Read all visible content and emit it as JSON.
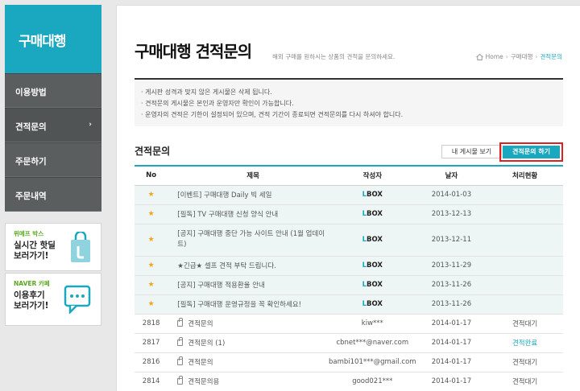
{
  "sidebar": {
    "title": "구매대행",
    "items": [
      {
        "label": "이용방법"
      },
      {
        "label": "견적문의",
        "arrow": "›"
      },
      {
        "label": "주문하기"
      },
      {
        "label": "주문내역"
      }
    ]
  },
  "banners": [
    {
      "tag": "위메프 박스",
      "line1": "실시간 핫딜",
      "line2": "보러가기!",
      "icon": "shopping-bag-icon"
    },
    {
      "tag": "NAVER 카페",
      "line1": "이용후기",
      "line2": "보러가기!",
      "icon": "chat-bubble-icon"
    }
  ],
  "header": {
    "title": "구매대행 견적문의",
    "description": "해외 구매를 원하시는 상품의 견적을 문의하세요.",
    "breadcrumb": {
      "home": "Home",
      "sep1": "›",
      "level1": "구매대행",
      "sep2": "›",
      "current": "견적문의"
    }
  },
  "notice": [
    "· 게시판 성격과 맞지 않은 게시물은 삭제 됩니다.",
    "· 견적문의 게시물은 본인과 운영자만 확인이 가능합니다.",
    "· 운영자의 견적은 기한이 설정되어 있으며, 견적 기간이 종료되면 견적문의를 다시 하셔야 합니다."
  ],
  "section": {
    "title": "견적문의",
    "my_posts_button": "내 게시물 보기",
    "ask_button": "견적문의 하기"
  },
  "table": {
    "headers": [
      "No",
      "제목",
      "작성자",
      "날자",
      "처리현황"
    ],
    "pinned": [
      {
        "subject": "[이벤트] 구매대행 Daily 빅 세일",
        "writer_l": "L",
        "writer": "BOX",
        "date": "2014-01-03",
        "status": ""
      },
      {
        "subject": "[필독] TV 구매대행 신청 양식 안내",
        "writer_l": "L",
        "writer": "BOX",
        "date": "2013-12-13",
        "status": ""
      },
      {
        "subject": "[공지] 구매대행 중단 가능 사이트 안내 (1월 업데이트)",
        "writer_l": "L",
        "writer": "BOX",
        "date": "2013-12-11",
        "status": ""
      },
      {
        "subject": "★긴급★ 셀프 견적 부탁 드립니다.",
        "writer_l": "L",
        "writer": "BOX",
        "date": "2013-11-29",
        "status": ""
      },
      {
        "subject": "[공지] 구매대행 적용환율 안내",
        "writer_l": "L",
        "writer": "BOX",
        "date": "2013-11-26",
        "status": ""
      },
      {
        "subject": "[필독] 구매대행 운영규정을 꼭 확인하세요!",
        "writer_l": "L",
        "writer": "BOX",
        "date": "2013-11-26",
        "status": ""
      }
    ],
    "rows": [
      {
        "no": "2818",
        "subject": "견적문의",
        "writer": "kiw***",
        "date": "2014-01-17",
        "status": "견적대기",
        "done": false
      },
      {
        "no": "2817",
        "subject": "견적문의 (1)",
        "writer": "cbnet***@naver.com",
        "date": "2014-01-17",
        "status": "견적완료",
        "done": true
      },
      {
        "no": "2816",
        "subject": "견적문의",
        "writer": "bambi101***@gmail.com",
        "date": "2014-01-17",
        "status": "견적대기",
        "done": false
      },
      {
        "no": "2814",
        "subject": "견적문의용",
        "writer": "good021***",
        "date": "2014-01-17",
        "status": "견적대기",
        "done": false
      }
    ]
  },
  "colors": {
    "accent": "#1aa8c0",
    "highlight_border": "#e02020",
    "star": "#f0a818"
  }
}
